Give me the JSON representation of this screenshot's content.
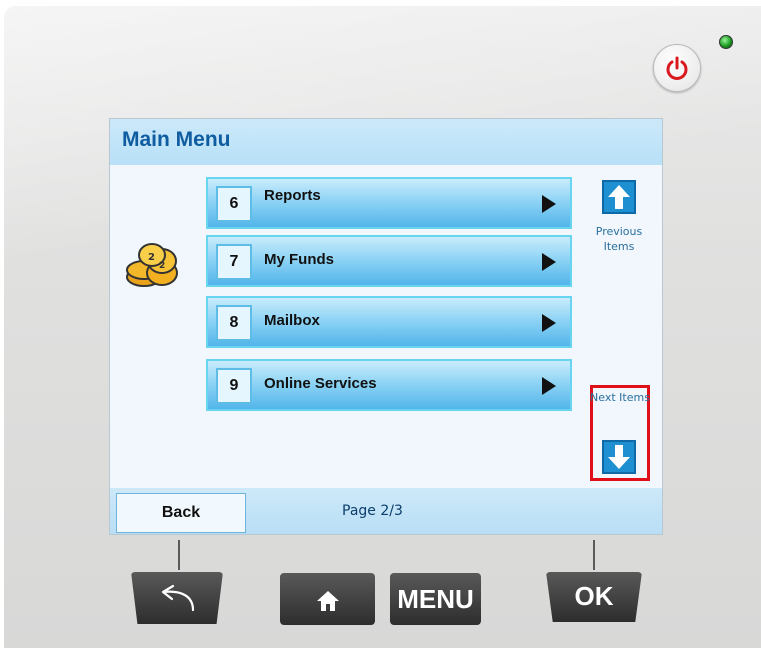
{
  "screen": {
    "title": "Main Menu",
    "menu_items": [
      {
        "number": "6",
        "label": "Reports"
      },
      {
        "number": "7",
        "label": "My Funds"
      },
      {
        "number": "8",
        "label": "Mailbox"
      },
      {
        "number": "9",
        "label": "Online Services"
      }
    ],
    "previous_items_label": "Previous Items",
    "next_items_label": "Next Items",
    "back_label": "Back",
    "page_indicator": "Page 2/3"
  },
  "hardware": {
    "menu_label": "MENU",
    "ok_label": "OK"
  },
  "icons": {
    "power": "power-icon",
    "coins": "coins-icon",
    "up_arrow": "up-arrow-icon",
    "down_arrow": "down-arrow-icon",
    "back": "undo-arrow-icon",
    "home": "home-icon"
  },
  "colors": {
    "title": "#0f5da0",
    "highlight_frame": "#e0101a",
    "nav_button": "#1e8fd0",
    "led": "#1c9b22"
  }
}
